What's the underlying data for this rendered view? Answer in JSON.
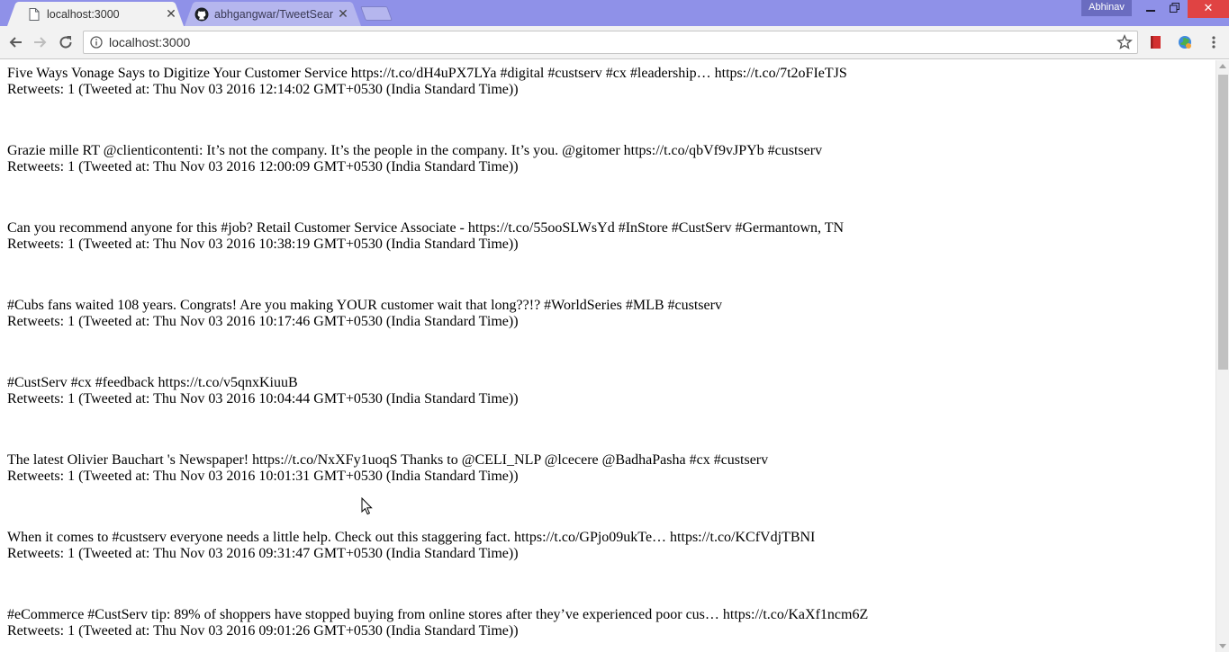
{
  "browser": {
    "tabs": [
      {
        "label": "localhost:3000",
        "icon": "page-icon",
        "active": true
      },
      {
        "label": "abhgangwar/TweetSearc",
        "icon": "github-icon",
        "active": false
      }
    ],
    "profile_name": "Abhinav",
    "address_bar": {
      "url": "localhost:3000"
    },
    "colors": {
      "titlebar": "#8f91e8",
      "toolbar": "#f2f2f2",
      "close_button": "#e04343"
    }
  },
  "tweets": [
    {
      "text": "Five Ways Vonage Says to Digitize Your Customer Service https://t.co/dH4uPX7LYa #digital #custserv #cx #leadership… https://t.co/7t2oFIeTJS",
      "meta": "Retweets: 1 (Tweeted at: Thu Nov 03 2016 12:14:02 GMT+0530 (India Standard Time))"
    },
    {
      "text": "Grazie mille RT @clienticontenti: It’s not the company. It’s the people in the company. It’s you. @gitomer https://t.co/qbVf9vJPYb #custserv",
      "meta": "Retweets: 1 (Tweeted at: Thu Nov 03 2016 12:00:09 GMT+0530 (India Standard Time))"
    },
    {
      "text": "Can you recommend anyone for this #job? Retail Customer Service Associate - https://t.co/55ooSLWsYd #InStore #CustServ #Germantown, TN",
      "meta": "Retweets: 1 (Tweeted at: Thu Nov 03 2016 10:38:19 GMT+0530 (India Standard Time))"
    },
    {
      "text": "#Cubs fans waited 108 years. Congrats! Are you making YOUR customer wait that long??!? #WorldSeries #MLB #custserv",
      "meta": "Retweets: 1 (Tweeted at: Thu Nov 03 2016 10:17:46 GMT+0530 (India Standard Time))"
    },
    {
      "text": "#CustServ #cx #feedback https://t.co/v5qnxKiuuB",
      "meta": "Retweets: 1 (Tweeted at: Thu Nov 03 2016 10:04:44 GMT+0530 (India Standard Time))"
    },
    {
      "text": "The latest Olivier Bauchart 's Newspaper! https://t.co/NxXFy1uoqS Thanks to @CELI_NLP @lcecere @BadhaPasha #cx #custserv",
      "meta": "Retweets: 1 (Tweeted at: Thu Nov 03 2016 10:01:31 GMT+0530 (India Standard Time))"
    },
    {
      "text": "When it comes to #custserv everyone needs a little help. Check out this staggering fact. https://t.co/GPjo09ukTe… https://t.co/KCfVdjTBNI",
      "meta": "Retweets: 1 (Tweeted at: Thu Nov 03 2016 09:31:47 GMT+0530 (India Standard Time))"
    },
    {
      "text": "#eCommerce #CustServ tip: 89% of shoppers have stopped buying from online stores after they’ve experienced poor cus… https://t.co/KaXf1ncm6Z",
      "meta": "Retweets: 1 (Tweeted at: Thu Nov 03 2016 09:01:26 GMT+0530 (India Standard Time))"
    }
  ]
}
